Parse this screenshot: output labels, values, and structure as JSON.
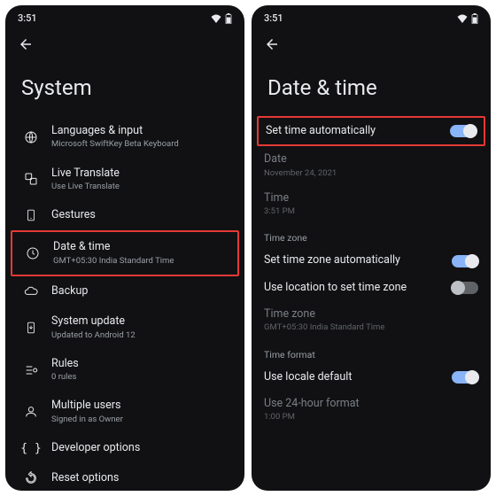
{
  "left": {
    "status_time": "3:51",
    "title": "System",
    "items": [
      {
        "icon": "globe",
        "label": "Languages & input",
        "sub": "Microsoft SwiftKey Beta Keyboard"
      },
      {
        "icon": "translate",
        "label": "Live Translate",
        "sub": "Use Live Translate"
      },
      {
        "icon": "gesture",
        "label": "Gestures",
        "sub": ""
      },
      {
        "icon": "clock",
        "label": "Date & time",
        "sub": "GMT+05:30 India Standard Time",
        "highlight": true
      },
      {
        "icon": "cloud",
        "label": "Backup",
        "sub": ""
      },
      {
        "icon": "update",
        "label": "System update",
        "sub": "Updated to Android 12"
      },
      {
        "icon": "rules",
        "label": "Rules",
        "sub": "0 rules"
      },
      {
        "icon": "users",
        "label": "Multiple users",
        "sub": "Signed in as Owner"
      },
      {
        "icon": "braces",
        "label": "Developer options",
        "sub": ""
      },
      {
        "icon": "reset",
        "label": "Reset options",
        "sub": ""
      }
    ]
  },
  "right": {
    "status_time": "3:51",
    "title": "Date & time",
    "set_time_auto": {
      "label": "Set time automatically",
      "on": true,
      "highlight": true
    },
    "date": {
      "label": "Date",
      "value": "November 24, 2021"
    },
    "time": {
      "label": "Time",
      "value": "3:51 PM"
    },
    "section_tz": "Time zone",
    "tz_auto": {
      "label": "Set time zone automatically",
      "on": true
    },
    "tz_location": {
      "label": "Use location to set time zone",
      "on": false
    },
    "tz": {
      "label": "Time zone",
      "value": "GMT+05:30 India Standard Time"
    },
    "section_format": "Time format",
    "locale_default": {
      "label": "Use locale default",
      "on": true
    },
    "use24": {
      "label": "Use 24-hour format",
      "value": "1:00 PM"
    }
  }
}
